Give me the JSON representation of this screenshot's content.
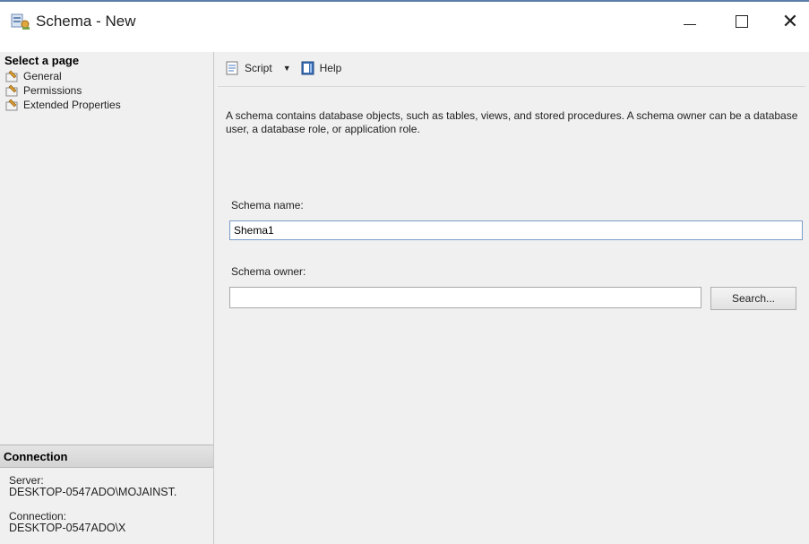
{
  "window": {
    "title": "Schema - New",
    "minimize_icon": "minimize-icon",
    "maximize_icon": "maximize-icon",
    "close_glyph": "✕"
  },
  "sidebar": {
    "header": "Select a page",
    "items": [
      {
        "label": "General",
        "icon": "wrench-page-icon"
      },
      {
        "label": "Permissions",
        "icon": "wrench-page-icon"
      },
      {
        "label": "Extended Properties",
        "icon": "wrench-page-icon"
      }
    ]
  },
  "connection": {
    "header": "Connection",
    "server_label": "Server:",
    "server_value": "DESKTOP-0547ADO\\MOJAINST.",
    "connection_label": "Connection:",
    "connection_value": "DESKTOP-0547ADO\\X"
  },
  "toolbar": {
    "script_label": "Script",
    "help_label": "Help"
  },
  "main": {
    "description": "A schema contains database objects, such as tables, views, and stored procedures. A schema owner can be a database user, a database role, or application role.",
    "schema_name_label": "Schema name:",
    "schema_name_value": "Shema1",
    "schema_owner_label": "Schema owner:",
    "schema_owner_value": "",
    "search_button": "Search..."
  }
}
